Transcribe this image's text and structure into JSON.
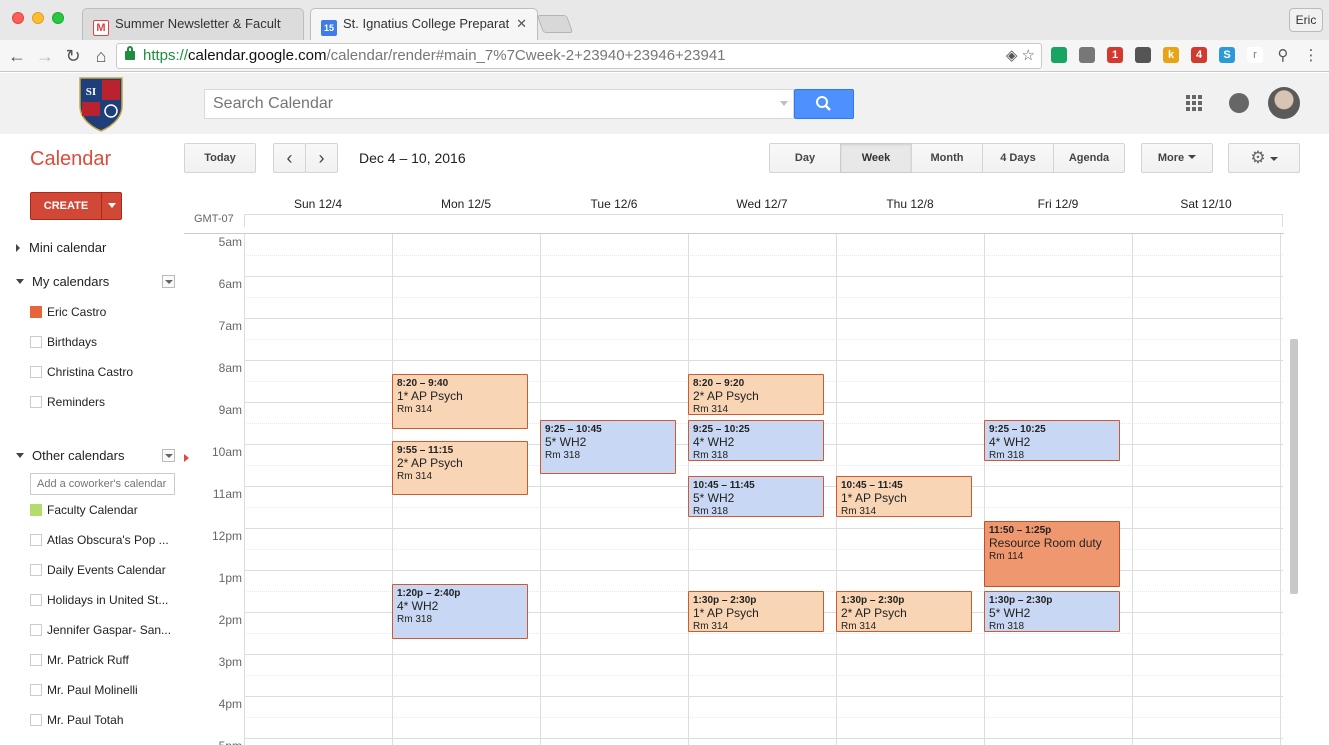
{
  "browser": {
    "tabs": [
      {
        "label": "Summer Newsletter & Faculty/",
        "icon": "gmail-icon"
      },
      {
        "label": "St. Ignatius College Preparator",
        "icon": "calendar-icon"
      }
    ],
    "profile": "Eric",
    "url": {
      "scheme": "https://",
      "host": "calendar.google.com",
      "path": "/calendar/render#main_7%7Cweek-2+23940+23946+23941"
    },
    "extensions": [
      {
        "name": "sync-extension-icon",
        "color": "#19a463",
        "text": ""
      },
      {
        "name": "evernote-icon",
        "color": "#777777",
        "text": ""
      },
      {
        "name": "adblock-icon",
        "color": "#d23a2f",
        "text": "1"
      },
      {
        "name": "info-extension-icon",
        "color": "#555555",
        "text": ""
      },
      {
        "name": "k-extension-icon",
        "color": "#e9a316",
        "text": "k"
      },
      {
        "name": "tool-extension-icon",
        "color": "#d23a2f",
        "text": "4"
      },
      {
        "name": "s-extension-icon",
        "color": "#2a9bd7",
        "text": "S"
      },
      {
        "name": "r-extension-icon",
        "color": "#ffffff",
        "text": "r"
      }
    ]
  },
  "header": {
    "search_placeholder": "Search Calendar",
    "title": "Calendar",
    "today": "Today",
    "date_range": "Dec 4 – 10, 2016",
    "views": [
      "Day",
      "Week",
      "Month",
      "4 Days",
      "Agenda"
    ],
    "active_view": "Week",
    "more": "More"
  },
  "sidebar": {
    "create": "CREATE",
    "mini_calendar": "Mini calendar",
    "my_calendars_title": "My calendars",
    "my_calendars": [
      {
        "label": "Eric Castro",
        "color": "#e8643b"
      },
      {
        "label": "Birthdays",
        "color": ""
      },
      {
        "label": "Christina Castro",
        "color": ""
      },
      {
        "label": "Reminders",
        "color": ""
      }
    ],
    "other_calendars_title": "Other calendars",
    "coworker_placeholder": "Add a coworker's calendar",
    "other_calendars": [
      {
        "label": "Faculty Calendar",
        "color": "#b3dc6c"
      },
      {
        "label": "Atlas Obscura's Pop ...",
        "color": ""
      },
      {
        "label": "Daily Events Calendar",
        "color": ""
      },
      {
        "label": "Holidays in United St...",
        "color": ""
      },
      {
        "label": "Jennifer Gaspar- San...",
        "color": ""
      },
      {
        "label": "Mr. Patrick Ruff",
        "color": ""
      },
      {
        "label": "Mr. Paul Molinelli",
        "color": ""
      },
      {
        "label": "Mr. Paul Totah",
        "color": ""
      }
    ]
  },
  "grid": {
    "timezone": "GMT-07",
    "days": [
      "Sun 12/4",
      "Mon 12/5",
      "Tue 12/6",
      "Wed 12/7",
      "Thu 12/8",
      "Fri 12/9",
      "Sat 12/10"
    ],
    "hours": [
      "5am",
      "6am",
      "7am",
      "8am",
      "9am",
      "10am",
      "11am",
      "12pm",
      "1pm",
      "2pm",
      "3pm",
      "4pm",
      "5pm"
    ]
  },
  "events": [
    {
      "day": 1,
      "start": 8.333,
      "end": 9.667,
      "time": "8:20 – 9:40",
      "title": "1* AP Psych",
      "room": "Rm 314",
      "style": "peach"
    },
    {
      "day": 1,
      "start": 9.917,
      "end": 11.25,
      "time": "9:55 – 11:15",
      "title": "2* AP Psych",
      "room": "Rm 314",
      "style": "peach"
    },
    {
      "day": 1,
      "start": 13.333,
      "end": 14.667,
      "time": "1:20p – 2:40p",
      "title": "4* WH2",
      "room": "Rm 318",
      "style": "blue"
    },
    {
      "day": 2,
      "start": 9.417,
      "end": 10.75,
      "time": "9:25 – 10:45",
      "title": "5* WH2",
      "room": "Rm 318",
      "style": "blue"
    },
    {
      "day": 3,
      "start": 8.333,
      "end": 9.333,
      "time": "8:20 – 9:20",
      "title": "2* AP Psych",
      "room": "Rm 314",
      "style": "peach"
    },
    {
      "day": 3,
      "start": 9.417,
      "end": 10.417,
      "time": "9:25 – 10:25",
      "title": "4* WH2",
      "room": "Rm 318",
      "style": "blue"
    },
    {
      "day": 3,
      "start": 10.75,
      "end": 11.75,
      "time": "10:45 – 11:45",
      "title": "5* WH2",
      "room": "Rm 318",
      "style": "blue"
    },
    {
      "day": 3,
      "start": 13.5,
      "end": 14.5,
      "time": "1:30p – 2:30p",
      "title": "1* AP Psych",
      "room": "Rm 314",
      "style": "peach"
    },
    {
      "day": 4,
      "start": 10.75,
      "end": 11.75,
      "time": "10:45 – 11:45",
      "title": "1* AP Psych",
      "room": "Rm 314",
      "style": "peach"
    },
    {
      "day": 4,
      "start": 13.5,
      "end": 14.5,
      "time": "1:30p – 2:30p",
      "title": "2* AP Psych",
      "room": "Rm 314",
      "style": "peach"
    },
    {
      "day": 5,
      "start": 9.417,
      "end": 10.417,
      "time": "9:25 – 10:25",
      "title": "4* WH2",
      "room": "Rm 318",
      "style": "blue"
    },
    {
      "day": 5,
      "start": 11.833,
      "end": 13.417,
      "time": "11:50 – 1:25p",
      "title": "Resource Room duty",
      "room": "Rm 114",
      "style": "orange"
    },
    {
      "day": 5,
      "start": 13.5,
      "end": 14.5,
      "time": "1:30p – 2:30p",
      "title": "5* WH2",
      "room": "Rm 318",
      "style": "blue"
    }
  ]
}
